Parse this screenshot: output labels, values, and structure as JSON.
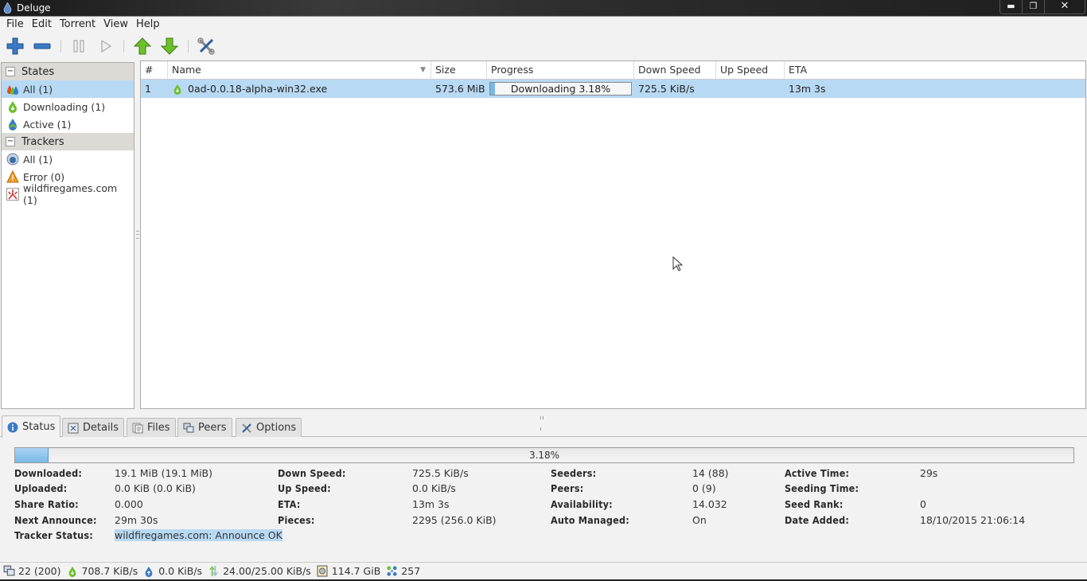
{
  "window": {
    "title": "Deluge",
    "minimize": "▬",
    "restore": "❐",
    "close": "✕"
  },
  "menu": [
    "File",
    "Edit",
    "Torrent",
    "View",
    "Help"
  ],
  "toolbar": {
    "buttons": [
      {
        "name": "add-torrent",
        "icon": "plus-icon"
      },
      {
        "name": "remove-torrent",
        "icon": "minus-icon"
      },
      {
        "name": "pause",
        "icon": "pause-icon"
      },
      {
        "name": "resume",
        "icon": "play-icon"
      },
      {
        "name": "queue-up",
        "icon": "arrow-up-icon"
      },
      {
        "name": "queue-down",
        "icon": "arrow-down-icon"
      },
      {
        "name": "preferences",
        "icon": "tools-icon"
      }
    ]
  },
  "sidebar": {
    "states_header": "States",
    "states": [
      {
        "label": "All (1)",
        "selected": true
      },
      {
        "label": "Downloading (1)"
      },
      {
        "label": "Active (1)"
      }
    ],
    "trackers_header": "Trackers",
    "trackers": [
      {
        "label": "All (1)"
      },
      {
        "label": "Error (0)"
      },
      {
        "label": "wildfiregames.com (1)"
      }
    ],
    "collapse_glyph": "−"
  },
  "torrent_list": {
    "columns": [
      "#",
      "Name",
      "Size",
      "Progress",
      "Down Speed",
      "Up Speed",
      "ETA"
    ],
    "sort_indicator": "▼",
    "rows": [
      {
        "index": "1",
        "name": "0ad-0.0.18-alpha-win32.exe",
        "size": "573.6 MiB",
        "progress_text": "Downloading 3.18%",
        "progress_fraction": 0.0318,
        "down_speed": "725.5 KiB/s",
        "up_speed": "",
        "eta": "13m 3s"
      }
    ]
  },
  "tabs": [
    "Status",
    "Details",
    "Files",
    "Peers",
    "Options"
  ],
  "status": {
    "progress_text": "3.18%",
    "progress_fraction": 0.0318,
    "col1": [
      {
        "label": "Downloaded:",
        "value": "19.1 MiB (19.1 MiB)"
      },
      {
        "label": "Uploaded:",
        "value": "0.0 KiB (0.0 KiB)"
      },
      {
        "label": "Share Ratio:",
        "value": "0.000"
      },
      {
        "label": "Next Announce:",
        "value": "29m 30s"
      },
      {
        "label": "Tracker Status:",
        "value": "wildfiregames.com: Announce OK"
      }
    ],
    "col2": [
      {
        "label": "Down Speed:",
        "value": "725.5 KiB/s"
      },
      {
        "label": "Up Speed:",
        "value": "0.0 KiB/s"
      },
      {
        "label": "ETA:",
        "value": "13m 3s"
      },
      {
        "label": "Pieces:",
        "value": "2295 (256.0 KiB)"
      }
    ],
    "col3": [
      {
        "label": "Seeders:",
        "value": "14 (88)"
      },
      {
        "label": "Peers:",
        "value": "0 (9)"
      },
      {
        "label": "Availability:",
        "value": "14.032"
      },
      {
        "label": "Auto Managed:",
        "value": "On"
      }
    ],
    "col4": [
      {
        "label": "Active Time:",
        "value": "29s"
      },
      {
        "label": "Seeding Time:",
        "value": ""
      },
      {
        "label": "Seed Rank:",
        "value": "0"
      },
      {
        "label": "Date Added:",
        "value": "18/10/2015 21:06:14"
      }
    ]
  },
  "statusbar": {
    "connections": "22 (200)",
    "download_speed": "708.7 KiB/s",
    "upload_speed": "0.0 KiB/s",
    "protocol_traffic": "24.00/25.00 KiB/s",
    "free_space": "114.7 GiB",
    "dht_nodes": "257"
  },
  "colors": {
    "selection": "#b8d9f3",
    "progress_fill": "#79b7e6",
    "accent_green": "#6cc02a",
    "accent_blue": "#2f6db5"
  }
}
